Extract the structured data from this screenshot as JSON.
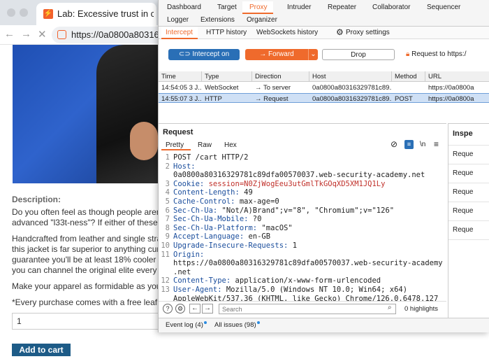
{
  "browser": {
    "tab_title": "Lab: Excessive trust in client-",
    "url": "https://0a0800a803163297",
    "product": {
      "description_heading": "Description:",
      "paragraph1_line1": "Do you often feel as though people aren't a",
      "paragraph1_line2": "advanced \"l33t-ness\"? If either of these thi",
      "paragraph2_line1": "Handcrafted from leather and single strand",
      "paragraph2_line2": "this jacket is far superior to anything curren",
      "paragraph2_line3": "guarantee you'll be at least 18% cooler wh",
      "paragraph2_line4": "you can channel the original elite every tim",
      "paragraph3": "Make your apparel as formidable as your in",
      "paragraph4": "*Every purchase comes with a free leaflet,",
      "quantity": "1",
      "add_to_cart": "Add to cart"
    }
  },
  "burp": {
    "main_tabs_row1": [
      "Dashboard",
      "Target",
      "Proxy",
      "Intruder",
      "Repeater",
      "Collaborator",
      "Sequencer"
    ],
    "main_tabs_row2": [
      "Logger",
      "Extensions",
      "Organizer"
    ],
    "sub_tabs": [
      "Intercept",
      "HTTP history",
      "WebSockets history",
      "Proxy settings"
    ],
    "toolbar": {
      "intercept": "Intercept on",
      "forward": "Forward",
      "drop": "Drop",
      "request_to": "Request to https:/"
    },
    "history_columns": [
      "Time",
      "Type",
      "Direction",
      "Host",
      "Method",
      "URL"
    ],
    "history_rows": [
      [
        "14:54:05 3 J...",
        "WebSocket",
        "→ To server",
        "0a0800a80316329781c89...",
        "",
        "https://0a0800a"
      ],
      [
        "14:55:07 3 J...",
        "HTTP",
        "→ Request",
        "0a0800a80316329781c89...",
        "POST",
        "https://0a0800a"
      ]
    ],
    "request_panel": {
      "title": "Request",
      "view_tabs": [
        "Pretty",
        "Raw",
        "Hex"
      ],
      "newline_toggle": "\\n",
      "lines": [
        {
          "n": "1",
          "k": "POST /cart HTTP/2",
          "v": ""
        },
        {
          "n": "2",
          "k": "Host:",
          "v": ""
        },
        {
          "n": "",
          "k": "",
          "v": "0a0800a80316329781c89dfa00570037.web-security-academy.net"
        },
        {
          "n": "3",
          "k": "Cookie: ",
          "v": "session=N0ZjWogEeu3utGmlTkGOqXD5XM1JQ1Ly"
        },
        {
          "n": "4",
          "k": "Content-Length: ",
          "v": "49"
        },
        {
          "n": "5",
          "k": "Cache-Control: ",
          "v": "max-age=0"
        },
        {
          "n": "6",
          "k": "Sec-Ch-Ua: ",
          "v": "\"Not/A)Brand\";v=\"8\", \"Chromium\";v=\"126\""
        },
        {
          "n": "7",
          "k": "Sec-Ch-Ua-Mobile: ",
          "v": "?0"
        },
        {
          "n": "8",
          "k": "Sec-Ch-Ua-Platform: ",
          "v": "\"macOS\""
        },
        {
          "n": "9",
          "k": "Accept-Language: ",
          "v": "en-GB"
        },
        {
          "n": "10",
          "k": "Upgrade-Insecure-Requests: ",
          "v": "1"
        },
        {
          "n": "11",
          "k": "Origin:",
          "v": ""
        },
        {
          "n": "",
          "k": "",
          "v": "https://0a0800a80316329781c89dfa00570037.web-security-academy"
        },
        {
          "n": "",
          "k": "",
          "v": ".net"
        },
        {
          "n": "12",
          "k": "Content-Type: ",
          "v": "application/x-www-form-urlencoded"
        },
        {
          "n": "13",
          "k": "User-Agent: ",
          "v": "Mozilla/5.0 (Windows NT 10.0; Win64; x64)"
        },
        {
          "n": "",
          "k": "",
          "v": "AppleWebKit/537.36 (KHTML, like Gecko) Chrome/126.0.6478.127"
        }
      ],
      "search_placeholder": "Search",
      "highlights": "0 highlights"
    },
    "inspector": {
      "title": "Inspe",
      "items": [
        "Reque",
        "Reque",
        "Reque",
        "Reque",
        "Reque"
      ]
    },
    "bottom": {
      "event_log": "Event log (4)",
      "all_issues": "All issues (98)"
    }
  }
}
